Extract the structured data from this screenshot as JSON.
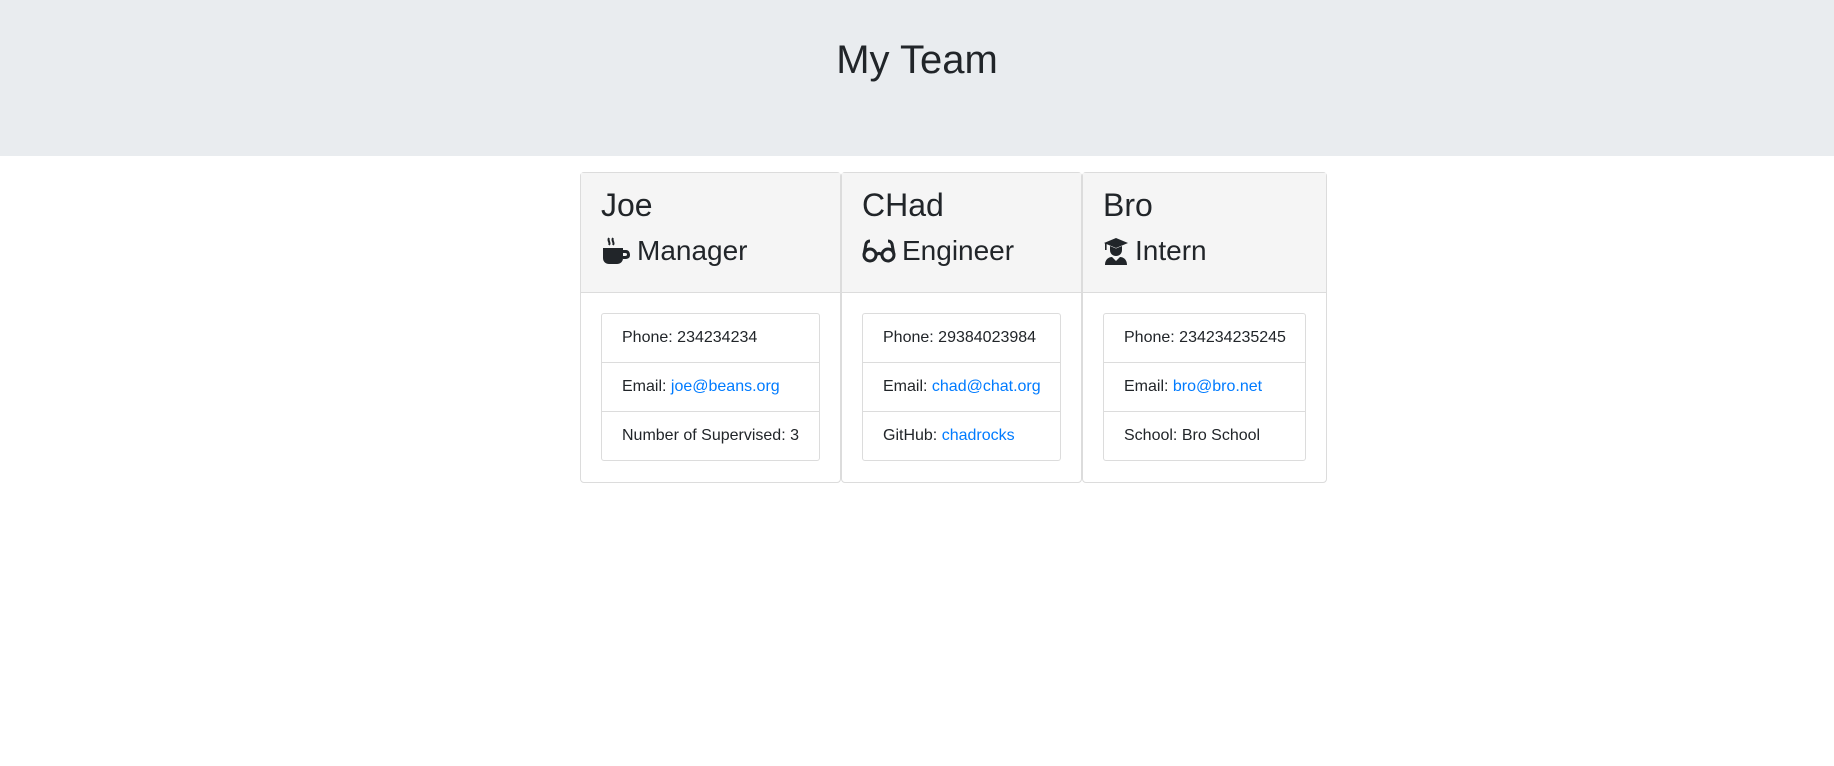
{
  "page": {
    "title": "My Team"
  },
  "colors": {
    "link": "#007bff",
    "header_bg": "#e9ecef",
    "card_header_bg": "#f5f5f5"
  },
  "employees": [
    {
      "name": "Joe",
      "role": "Manager",
      "icon": "coffee-icon",
      "phone_label": "Phone:",
      "phone": "234234234",
      "email_label": "Email:",
      "email": "joe@beans.org",
      "extra_label": "Number of Supervised:",
      "extra_value": "3"
    },
    {
      "name": "CHad",
      "role": "Engineer",
      "icon": "glasses-icon",
      "phone_label": "Phone:",
      "phone": "29384023984",
      "email_label": "Email:",
      "email": "chad@chat.org",
      "extra_label": "GitHub:",
      "extra_value": "chadrocks"
    },
    {
      "name": "Bro",
      "role": "Intern",
      "icon": "graduate-icon",
      "phone_label": "Phone:",
      "phone": "234234235245",
      "email_label": "Email:",
      "email": "bro@bro.net",
      "extra_label": "School:",
      "extra_value": "Bro School"
    }
  ]
}
